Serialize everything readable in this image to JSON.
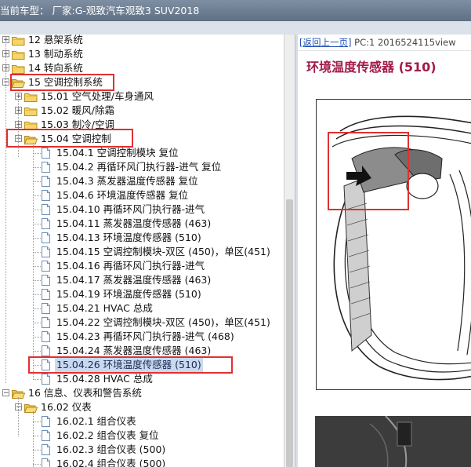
{
  "titlebar": {
    "prefix": "当前车型：",
    "vehicle": "厂家:G-观致汽车观致3 SUV2018"
  },
  "tree": [
    {
      "type": "folder",
      "state": "collapsed",
      "level": 0,
      "label": "12 悬架系统"
    },
    {
      "type": "folder",
      "state": "collapsed",
      "level": 0,
      "label": "13 制动系统"
    },
    {
      "type": "folder",
      "state": "collapsed",
      "level": 0,
      "label": "14 转向系统"
    },
    {
      "type": "folder",
      "state": "expanded",
      "level": 0,
      "label": "15 空调控制系统",
      "highlight": true
    },
    {
      "type": "folder",
      "state": "collapsed",
      "level": 1,
      "label": "15.01 空气处理/车身通风"
    },
    {
      "type": "folder",
      "state": "collapsed",
      "level": 1,
      "label": "15.02 暖风/除霜"
    },
    {
      "type": "folder",
      "state": "collapsed",
      "level": 1,
      "label": "15.03 制冷/空调"
    },
    {
      "type": "folder",
      "state": "expanded",
      "level": 1,
      "label": "15.04 空调控制",
      "highlight": true
    },
    {
      "type": "doc",
      "level": 2,
      "label": "15.04.1 空调控制模块 复位"
    },
    {
      "type": "doc",
      "level": 2,
      "label": "15.04.2 再循环风门执行器-进气 复位"
    },
    {
      "type": "doc",
      "level": 2,
      "label": "15.04.3 蒸发器温度传感器 复位"
    },
    {
      "type": "doc",
      "level": 2,
      "label": "15.04.6 环境温度传感器 复位"
    },
    {
      "type": "doc",
      "level": 2,
      "label": "15.04.10 再循环风门执行器-进气"
    },
    {
      "type": "doc",
      "level": 2,
      "label": "15.04.11 蒸发器温度传感器 (463)"
    },
    {
      "type": "doc",
      "level": 2,
      "label": "15.04.13 环境温度传感器 (510)"
    },
    {
      "type": "doc",
      "level": 2,
      "label": "15.04.15 空调控制模块-双区 (450)，单区(451)"
    },
    {
      "type": "doc",
      "level": 2,
      "label": "15.04.16 再循环风门执行器-进气"
    },
    {
      "type": "doc",
      "level": 2,
      "label": "15.04.17 蒸发器温度传感器 (463)"
    },
    {
      "type": "doc",
      "level": 2,
      "label": "15.04.19 环境温度传感器 (510)"
    },
    {
      "type": "doc",
      "level": 2,
      "label": "15.04.21 HVAC 总成"
    },
    {
      "type": "doc",
      "level": 2,
      "label": "15.04.22 空调控制模块-双区 (450)，单区(451)"
    },
    {
      "type": "doc",
      "level": 2,
      "label": "15.04.23 再循环风门执行器-进气 (468)"
    },
    {
      "type": "doc",
      "level": 2,
      "label": "15.04.24 蒸发器温度传感器 (463)"
    },
    {
      "type": "doc",
      "level": 2,
      "label": "15.04.26 环境温度传感器 (510)",
      "selected": true,
      "highlight": true
    },
    {
      "type": "doc",
      "level": 2,
      "label": "15.04.28 HVAC 总成"
    },
    {
      "type": "folder",
      "state": "expanded",
      "level": 0,
      "label": "16 信息、仪表和警告系统"
    },
    {
      "type": "folder",
      "state": "expanded",
      "level": 1,
      "label": "16.02 仪表"
    },
    {
      "type": "doc",
      "level": 2,
      "label": "16.02.1 组合仪表"
    },
    {
      "type": "doc",
      "level": 2,
      "label": "16.02.2 组合仪表 复位"
    },
    {
      "type": "doc",
      "level": 2,
      "label": "16.02.3 组合仪表 (500)"
    },
    {
      "type": "doc",
      "level": 2,
      "label": "16.02.4 组合仪表 (500)"
    }
  ],
  "content": {
    "back_link": "[返回上一页]",
    "page_info": "PC:1 2016524115view",
    "title": "环境温度传感器 (510)"
  },
  "colors": {
    "highlight_box": "#e03030",
    "title_color": "#a2194a",
    "selection_bg": "#c9d9ee",
    "link": "#1f4db3"
  }
}
